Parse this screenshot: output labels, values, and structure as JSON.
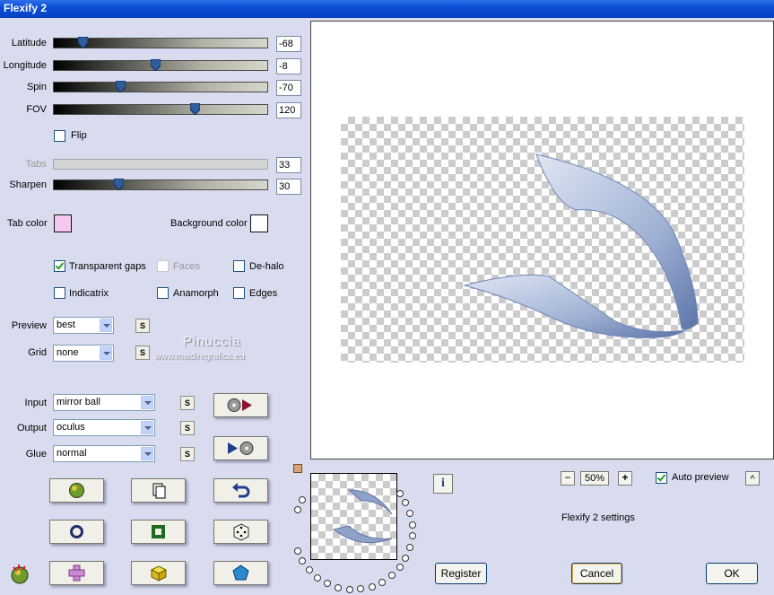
{
  "window": {
    "title": "Flexify 2"
  },
  "sliders": [
    {
      "label": "Latitude",
      "value": "-68",
      "level": 0.12
    },
    {
      "label": "Longitude",
      "value": "-8",
      "level": 0.47
    },
    {
      "label": "Spin",
      "value": "-70",
      "level": 0.31
    },
    {
      "label": "FOV",
      "value": "120",
      "level": 0.66
    }
  ],
  "flip": {
    "label": "Flip",
    "checked": false
  },
  "tabs": {
    "label": "Tabs",
    "value": "33",
    "enabled": false
  },
  "sharpen": {
    "label": "Sharpen",
    "value": "30",
    "level": 0.3
  },
  "colors": {
    "tab_label": "Tab color",
    "tab_color": "#f6c8f0",
    "background_label": "Background color",
    "background_color": "#ffffff"
  },
  "options": {
    "transparent_gaps": {
      "label": "Transparent gaps",
      "checked": true
    },
    "faces": {
      "label": "Faces",
      "checked": false
    },
    "de_halo": {
      "label": "De-halo",
      "checked": false
    },
    "indicatrix": {
      "label": "Indicatrix",
      "checked": false
    },
    "anamorph": {
      "label": "Anamorph",
      "checked": false
    },
    "edges": {
      "label": "Edges",
      "checked": false
    }
  },
  "preview_sel": {
    "label": "Preview",
    "value": "best"
  },
  "grid_sel": {
    "label": "Grid",
    "value": "none"
  },
  "watermark": {
    "name": "Pinuccia",
    "site": "www.maidiregrafica.eu"
  },
  "input_sel": {
    "label": "Input",
    "value": "mirror ball"
  },
  "output_sel": {
    "label": "Output",
    "value": "oculus"
  },
  "glue_sel": {
    "label": "Glue",
    "value": "normal"
  },
  "s_button": "S",
  "info_button": "i",
  "zoom": {
    "minus": "−",
    "value": "50%",
    "plus": "+"
  },
  "auto_preview": {
    "label": "Auto preview",
    "checked": true
  },
  "caret_button": "^",
  "settings_label": "Flexify 2 settings",
  "buttons": {
    "register": "Register",
    "cancel": "Cancel",
    "ok": "OK"
  },
  "icons": {
    "toolbar": [
      "randomize-globe-icon",
      "copy-icon",
      "undo-icon",
      "ring-icon",
      "square-frame-icon",
      "dice-icon",
      "plus-cross-icon",
      "cube-icon",
      "pentagon-icon"
    ],
    "app_logo": "flexify-logo-icon"
  },
  "accent": {
    "title_bar": "#0a4fd6",
    "preview_shape": "#6f86b8",
    "check": "#21a121"
  }
}
